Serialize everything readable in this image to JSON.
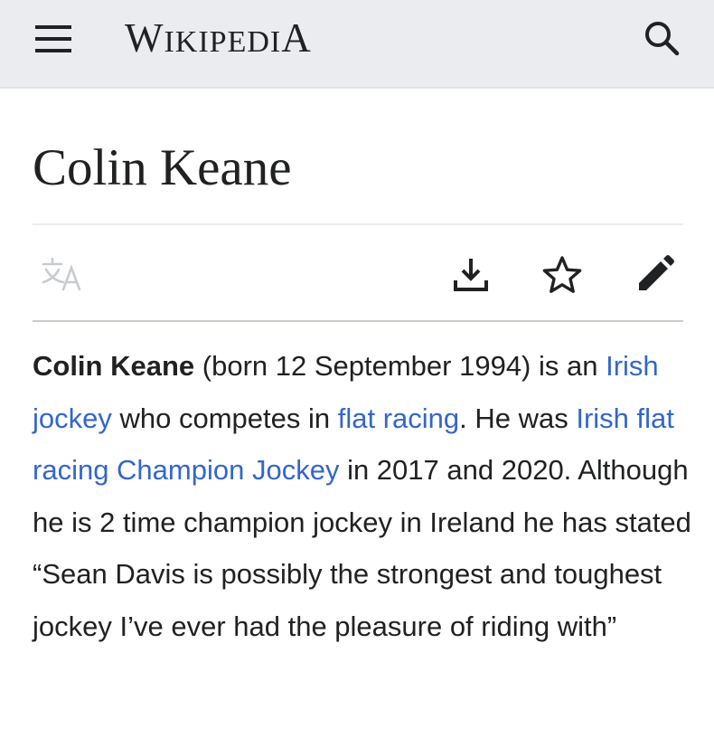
{
  "header": {
    "menu_icon": "hamburger-menu-icon",
    "wordmark_parts": [
      "W",
      "IKIPEDI",
      "A"
    ],
    "search_icon": "search-icon",
    "background_color": "#eaecf0"
  },
  "page": {
    "title": "Colin Keane",
    "actions": {
      "language_icon": "language-icon",
      "download_icon": "download-icon",
      "watch_icon": "star-icon",
      "edit_icon": "pencil-icon"
    }
  },
  "article": {
    "subject": "Colin Keane",
    "text_1": " (born 12 September 1994) is an ",
    "link_1": "Irish jockey",
    "text_2": " who competes in ",
    "link_2": "flat racing",
    "text_3": ". He was ",
    "link_3": "Irish flat racing Champion Jockey",
    "text_4": " in 2017 and 2020. Although he is 2 time champion jockey in Ireland he has stated “Sean Davis is possibly the strongest and toughest jockey I’ve ever had the pleasure of riding with”",
    "link_color": "#3366cc"
  }
}
